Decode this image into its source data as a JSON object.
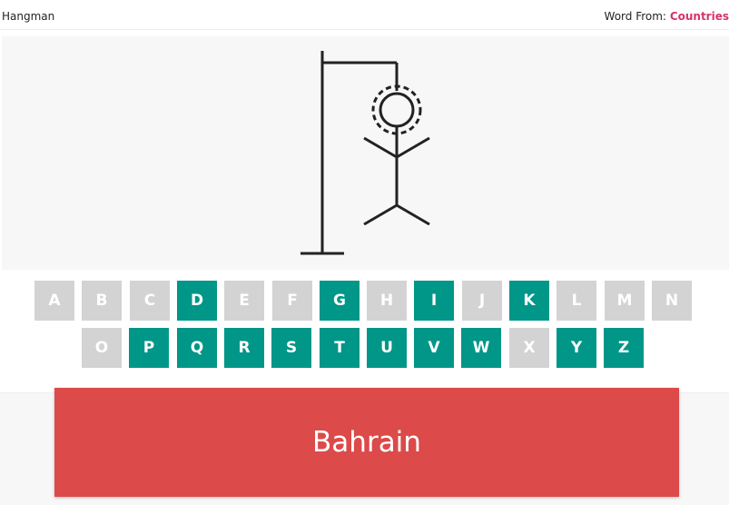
{
  "header": {
    "title": "Hangman",
    "word_from_label": "Word From:",
    "category": "Countries"
  },
  "keyboard": {
    "rows": [
      [
        {
          "letter": "A",
          "used": true
        },
        {
          "letter": "B",
          "used": true
        },
        {
          "letter": "C",
          "used": true
        },
        {
          "letter": "D",
          "used": false
        },
        {
          "letter": "E",
          "used": true
        },
        {
          "letter": "F",
          "used": true
        },
        {
          "letter": "G",
          "used": false
        },
        {
          "letter": "H",
          "used": true
        },
        {
          "letter": "I",
          "used": false
        },
        {
          "letter": "J",
          "used": true
        },
        {
          "letter": "K",
          "used": false
        },
        {
          "letter": "L",
          "used": true
        },
        {
          "letter": "M",
          "used": true
        },
        {
          "letter": "N",
          "used": true
        }
      ],
      [
        {
          "letter": "O",
          "used": true
        },
        {
          "letter": "P",
          "used": false
        },
        {
          "letter": "Q",
          "used": false
        },
        {
          "letter": "R",
          "used": false
        },
        {
          "letter": "S",
          "used": false
        },
        {
          "letter": "T",
          "used": false
        },
        {
          "letter": "U",
          "used": false
        },
        {
          "letter": "V",
          "used": false
        },
        {
          "letter": "W",
          "used": false
        },
        {
          "letter": "X",
          "used": true
        },
        {
          "letter": "Y",
          "used": false
        },
        {
          "letter": "Z",
          "used": false
        }
      ]
    ]
  },
  "result": {
    "word": "Bahrain"
  },
  "colors": {
    "available_key": "#009688",
    "used_key": "#d3d3d3",
    "category": "#d6336c",
    "result_banner": "#dc4a4a"
  }
}
